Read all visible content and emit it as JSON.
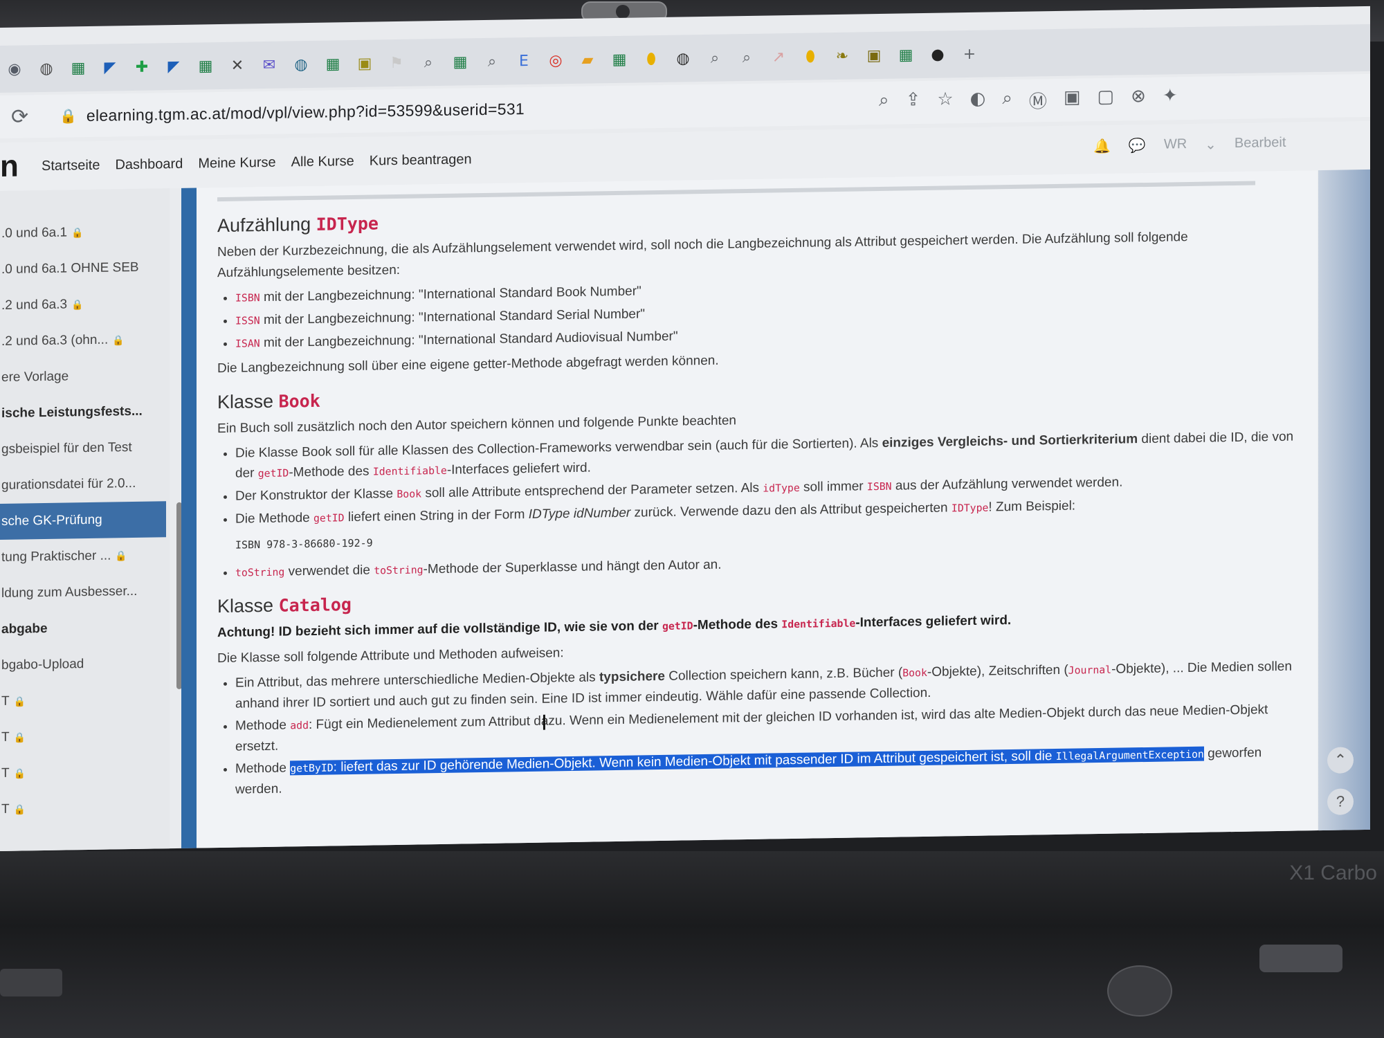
{
  "browser": {
    "tab_icons": [
      {
        "icon": "moodle-icon",
        "color": "#555b66"
      },
      {
        "icon": "globe-icon",
        "color": "#4a4a4a"
      },
      {
        "icon": "sheet-icon",
        "color": "#1e7e45"
      },
      {
        "icon": "flag-icon",
        "color": "#1d5fb8"
      },
      {
        "icon": "plus-box-icon",
        "color": "#1e9e45"
      },
      {
        "icon": "flag-icon",
        "color": "#1d5fb8"
      },
      {
        "icon": "sheet-icon",
        "color": "#1e7e45"
      },
      {
        "icon": "close-icon",
        "color": "#444444"
      },
      {
        "icon": "mail-icon",
        "color": "#5a4fc9"
      },
      {
        "icon": "globe-icon",
        "color": "#2a6a8a"
      },
      {
        "icon": "sheet-icon",
        "color": "#1e7e45"
      },
      {
        "icon": "box-icon",
        "color": "#9a8b16"
      },
      {
        "icon": "bookmark-icon",
        "color": "#c9c9c9"
      },
      {
        "icon": "search-icon",
        "color": "#5f6368"
      },
      {
        "icon": "sheet-icon",
        "color": "#1e7e45"
      },
      {
        "icon": "search-icon",
        "color": "#5f6368"
      },
      {
        "icon": "e-icon",
        "color": "#3a6fd8"
      },
      {
        "icon": "target-icon",
        "color": "#d93025"
      },
      {
        "icon": "folder-icon",
        "color": "#e6a020"
      },
      {
        "icon": "sheet-icon",
        "color": "#1e7e45"
      },
      {
        "icon": "map-pin-icon",
        "color": "#e8b000"
      },
      {
        "icon": "globe-icon",
        "color": "#333333"
      },
      {
        "icon": "search-icon",
        "color": "#5f6368"
      },
      {
        "icon": "search-icon",
        "color": "#5f6368"
      },
      {
        "icon": "chart-icon",
        "color": "#d9a0a0"
      },
      {
        "icon": "map-pin-icon",
        "color": "#e8b000"
      },
      {
        "icon": "leaf-icon",
        "color": "#8a7a10"
      },
      {
        "icon": "box-icon",
        "color": "#7a6a10"
      },
      {
        "icon": "sheet-icon",
        "color": "#1e7e45"
      },
      {
        "icon": "github-icon",
        "color": "#222222"
      },
      {
        "icon": "plus-icon",
        "color": "#5f6368"
      }
    ],
    "url": "elearning.tgm.ac.at/mod/vpl/view.php?id=53599&userid=531"
  },
  "nav": {
    "links": [
      "Startseite",
      "Dashboard",
      "Meine Kurse",
      "Alle Kurse",
      "Kurs beantragen"
    ],
    "user_initials": "WR",
    "edit_label": "Bearbeit"
  },
  "sidebar": {
    "items": [
      {
        "label": ".0 und 6a.1",
        "locked": true,
        "bold": false,
        "active": false
      },
      {
        "label": ".0 und 6a.1 OHNE SEB",
        "locked": false,
        "bold": false,
        "active": false
      },
      {
        "label": ".2 und 6a.3",
        "locked": true,
        "bold": false,
        "active": false
      },
      {
        "label": ".2 und 6a.3 (ohn...",
        "locked": true,
        "bold": false,
        "active": false
      },
      {
        "label": "ere Vorlage",
        "locked": false,
        "bold": false,
        "active": false
      },
      {
        "label": "ische Leistungsfests...",
        "locked": false,
        "bold": true,
        "active": false
      },
      {
        "label": "gsbeispiel für den Test",
        "locked": false,
        "bold": false,
        "active": false
      },
      {
        "label": "gurationsdatei für 2.0...",
        "locked": false,
        "bold": false,
        "active": false
      },
      {
        "label": "sche GK-Prüfung",
        "locked": false,
        "bold": false,
        "active": true
      },
      {
        "label": "tung Praktischer ...",
        "locked": true,
        "bold": false,
        "active": false
      },
      {
        "label": "ldung zum Ausbesser...",
        "locked": false,
        "bold": false,
        "active": false
      },
      {
        "label": "abgabe",
        "locked": false,
        "bold": true,
        "active": false
      },
      {
        "label": "bgabo-Upload",
        "locked": false,
        "bold": false,
        "active": false
      },
      {
        "label": "T",
        "locked": true,
        "bold": false,
        "active": false
      },
      {
        "label": "T",
        "locked": true,
        "bold": false,
        "active": false
      },
      {
        "label": "T",
        "locked": true,
        "bold": false,
        "active": false
      },
      {
        "label": "T",
        "locked": true,
        "bold": false,
        "active": false
      }
    ]
  },
  "content": {
    "s1": {
      "title": "Aufzählung",
      "title_code": "IDType",
      "intro": "Neben der Kurzbezeichnung, die als Aufzählungselement verwendet wird, soll noch die Langbezeichnung als Attribut gespeichert werden. Die Aufzählung soll folgende Aufzählungselemente besitzen:",
      "items": [
        {
          "code": "ISBN",
          "text": " mit der Langbezeichnung: \"International Standard Book Number\""
        },
        {
          "code": "ISSN",
          "text": " mit der Langbezeichnung: \"International Standard Serial Number\""
        },
        {
          "code": "ISAN",
          "text": " mit der Langbezeichnung: \"International Standard Audiovisual Number\""
        }
      ],
      "outro": "Die Langbezeichnung soll über eine eigene getter-Methode abgefragt werden können."
    },
    "s2": {
      "title": "Klasse",
      "title_code": "Book",
      "intro": "Ein Buch soll zusätzlich noch den Autor speichern können und folgende Punkte beachten",
      "b1_a": "Die Klasse Book soll für alle Klassen des Collection-Frameworks verwendbar sein (auch für die Sortierten). Als ",
      "b1_bold": "einziges Vergleichs- und Sortierkriterium",
      "b1_b": " dient dabei die ID, die von der ",
      "b1_code1": "getID",
      "b1_c": "-Methode des ",
      "b1_code2": "Identifiable",
      "b1_d": "-Interfaces geliefert wird.",
      "b2_a": "Der Konstruktor der Klasse ",
      "b2_code1": "Book",
      "b2_b": " soll alle Attribute entsprechend der Parameter setzen. Als ",
      "b2_code2": "idType",
      "b2_c": " soll immer ",
      "b2_code3": "ISBN",
      "b2_d": " aus der Aufzählung verwendet werden.",
      "b3_a": "Die Methode ",
      "b3_code1": "getID",
      "b3_b": " liefert einen String in der Form ",
      "b3_ital": "IDType idNumber",
      "b3_c": " zurück. Verwende dazu den als Attribut gespeicherten ",
      "b3_code2": "IDType",
      "b3_d": "! Zum Beispiel:",
      "example": "ISBN 978-3-86680-192-9",
      "b4_code1": "toString",
      "b4_a": " verwendet die ",
      "b4_code2": "toString",
      "b4_b": "-Methode der Superklasse und hängt den Autor an."
    },
    "s3": {
      "title": "Klasse",
      "title_code": "Catalog",
      "warn_a": "Achtung! ID bezieht sich immer auf die vollständige ID, wie sie von der ",
      "warn_code1": "getID",
      "warn_b": "-Methode des ",
      "warn_code2": "Identifiable",
      "warn_c": "-Interfaces geliefert wird.",
      "intro": "Die Klasse soll folgende Attribute und Methoden aufweisen:",
      "b1_a": "Ein Attribut, das mehrere unterschiedliche Medien-Objekte als ",
      "b1_bold": "typsichere",
      "b1_b": " Collection speichern kann, z.B. Bücher (",
      "b1_code1": "Book",
      "b1_c": "-Objekte), Zeitschriften (",
      "b1_code2": "Journal",
      "b1_d": "-Objekte), ... Die Medien sollen anhand ihrer ID sortiert und auch gut zu finden sein. Eine ID ist immer eindeutig. Wähle dafür eine passende Collection.",
      "b2_a": "Methode ",
      "b2_code": "add",
      "b2_b": ": Fügt ein Medienelement zum Attribut dazu. Wenn ein Medienelement mit der gleichen ID vorhanden ist, wird das alte Medien-Objekt durch das neue Medien-Objekt ersetzt.",
      "b3_a": "Methode ",
      "b3_code1": "getByID",
      "b3_b": ": liefert das zur ID gehörende Medien-Objekt. Wenn kein Medien-Objekt mit passender ID im Attribut gespeichert ist, soll die ",
      "b3_code2": "IllegalArgumentException",
      "b3_c": " geworfen werden."
    }
  },
  "floating": {
    "up": "⌃",
    "help": "?"
  },
  "device": {
    "brand": "X1 Carbo"
  }
}
